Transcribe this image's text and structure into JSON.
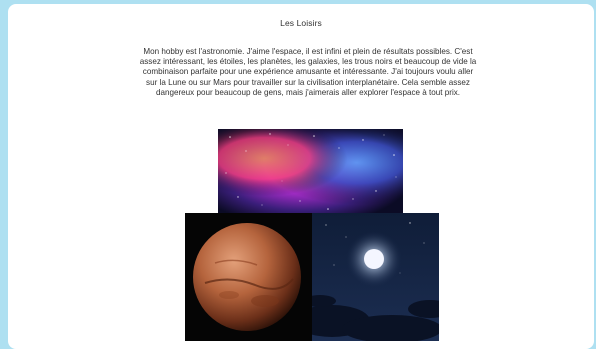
{
  "page": {
    "title": "Les Loisirs",
    "paragraph": "Mon hobby est l'astronomie. J'aime l'espace, il est infini et plein de résultats possibles. C'est assez intéressant, les étoiles, les planètes, les galaxies, les trous noirs et beaucoup de vide la combinaison parfaite pour une expérience amusante et intéressante. J'ai toujours voulu aller sur la Lune ou sur Mars pour travailler sur la civilisation interplanétaire. Cela semble assez dangereux pour beaucoup de gens, mais j'aimerais aller explorer l'espace à tout prix."
  },
  "images": [
    {
      "name": "nebula-image",
      "depicts": "colorful space nebula"
    },
    {
      "name": "mars-image",
      "depicts": "planet Mars"
    },
    {
      "name": "moon-image",
      "depicts": "full moon over night clouds"
    }
  ],
  "colors": {
    "page_background": "#aee0f1",
    "card_background": "#ffffff",
    "text": "#333333"
  }
}
